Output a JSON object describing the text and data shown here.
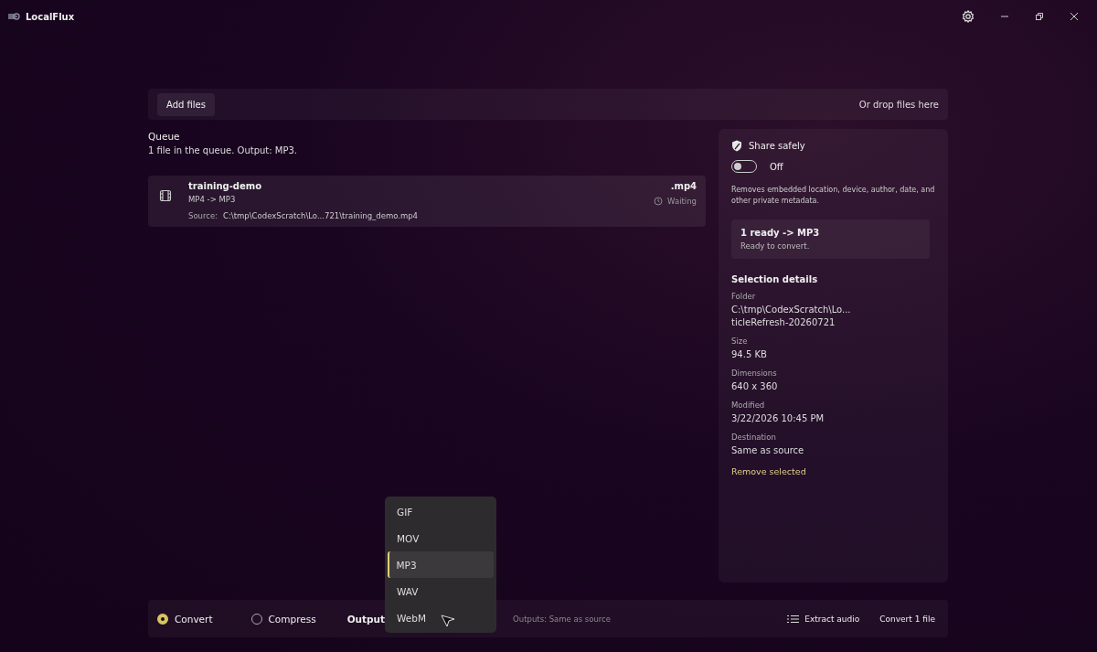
{
  "app": {
    "title": "LocalFlux"
  },
  "drop_bar": {
    "add_button": "Add files",
    "hint": "Or drop files here"
  },
  "queue": {
    "title": "Queue",
    "summary": "1 file in the queue. Output: MP3.",
    "items": [
      {
        "name": "training-demo",
        "conversion": "MP4 -> MP3",
        "extension": ".mp4",
        "status": "Waiting",
        "source_label": "Source:",
        "source_path": "C:\\tmp\\CodexScratch\\Lo...721\\training_demo.mp4"
      }
    ]
  },
  "side_panel": {
    "share_title": "Share safely",
    "share_toggle": {
      "on": false,
      "label": "Off"
    },
    "share_description": "Removes embedded location, device, author, date, and other private metadata.",
    "ready_card": {
      "title": "1 ready -> MP3",
      "subtitle": "Ready to convert."
    },
    "details_title": "Selection details",
    "details": [
      {
        "label": "Folder",
        "value": "C:\\tmp\\CodexScratch\\Lo...\nticleRefresh-20260721"
      },
      {
        "label": "Size",
        "value": "94.5 KB"
      },
      {
        "label": "Dimensions",
        "value": "640 x 360"
      },
      {
        "label": "Modified",
        "value": "3/22/2026 10:45 PM"
      },
      {
        "label": "Destination",
        "value": "Same as source"
      }
    ],
    "remove_link": "Remove selected"
  },
  "bottom_bar": {
    "modes": [
      {
        "label": "Convert",
        "selected": true
      },
      {
        "label": "Compress",
        "selected": false
      }
    ],
    "output_label": "Output",
    "outputs_hint": "Outputs: Same as source",
    "extract_button": "Extract audio",
    "convert_button": "Convert 1 file"
  },
  "format_menu": [
    {
      "label": "GIF",
      "selected": false
    },
    {
      "label": "MOV",
      "selected": false
    },
    {
      "label": "MP3",
      "selected": true
    },
    {
      "label": "WAV",
      "selected": false
    },
    {
      "label": "WebM",
      "selected": false
    }
  ]
}
